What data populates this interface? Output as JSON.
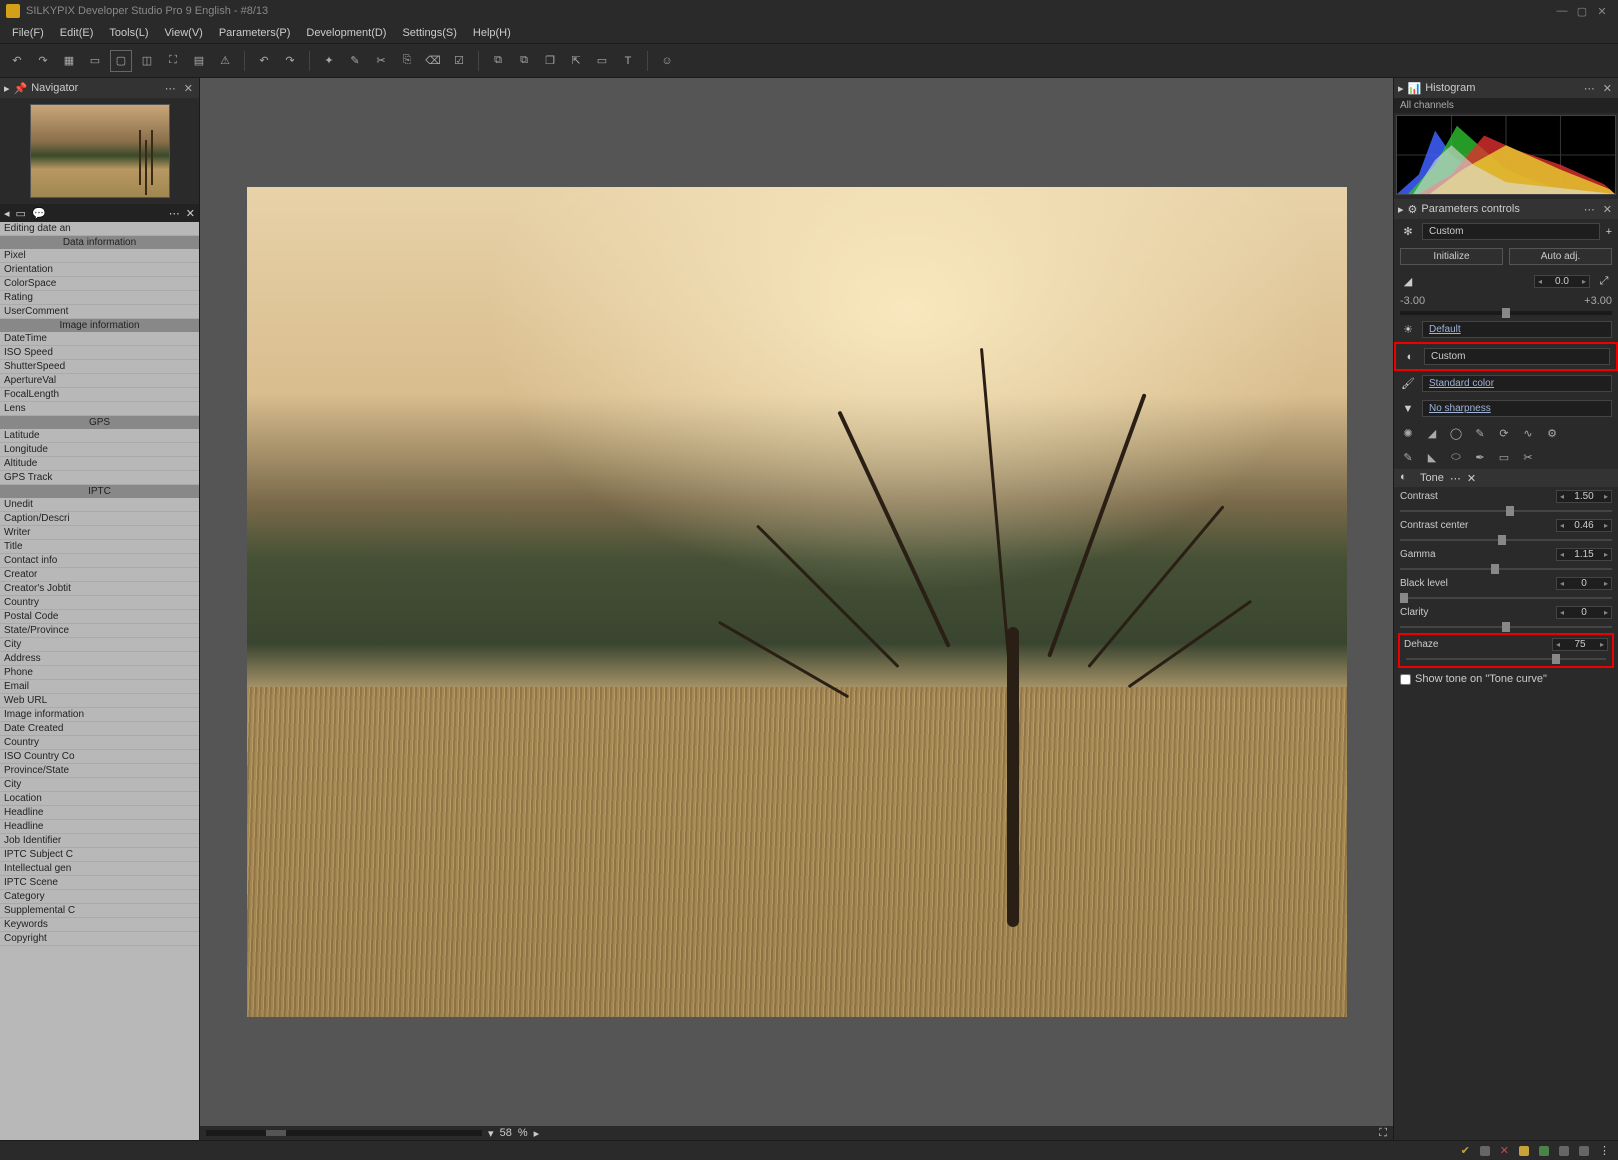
{
  "title": "SILKYPIX Developer Studio Pro 9 English - #8/13",
  "menu": [
    "File(F)",
    "Edit(E)",
    "Tools(L)",
    "View(V)",
    "Parameters(P)",
    "Development(D)",
    "Settings(S)",
    "Help(H)"
  ],
  "navigator": {
    "title": "Navigator"
  },
  "info_sections": {
    "editing": "Editing date an",
    "data": {
      "header": "Data information",
      "rows": [
        "Pixel",
        "Orientation",
        "ColorSpace",
        "Rating",
        "UserComment"
      ]
    },
    "image": {
      "header": "Image information",
      "rows": [
        "DateTime",
        "ISO Speed",
        "ShutterSpeed",
        "ApertureVal",
        "FocalLength",
        "Lens"
      ]
    },
    "gps": {
      "header": "GPS",
      "rows": [
        "Latitude",
        "Longitude",
        "Altitude",
        "GPS Track"
      ]
    },
    "iptc": {
      "header": "IPTC",
      "rows": [
        "Unedit",
        "Caption/Descri",
        "Writer",
        "Title",
        "Contact info",
        "Creator",
        "Creator's Jobtit",
        "Country",
        "Postal Code",
        "State/Province",
        "City",
        "Address",
        "Phone",
        "Email",
        "Web URL",
        "Image information",
        "Date Created",
        "Country",
        "ISO Country Co",
        "Province/State",
        "City",
        "Location",
        "Headline",
        "Headline",
        "Job Identifier",
        "IPTC Subject C",
        "Intellectual gen",
        "IPTC Scene",
        "Category",
        "Supplemental C",
        "Keywords",
        "Copyright"
      ]
    }
  },
  "zoom": {
    "value": "58",
    "unit": "%"
  },
  "histogram": {
    "title": "Histogram",
    "channels": "All channels"
  },
  "params_controls": {
    "title": "Parameters controls",
    "preset": "Custom",
    "init": "Initialize",
    "auto": "Auto adj.",
    "exp_value": "0.0",
    "exp_min": "-3.00",
    "exp_max": "+3.00"
  },
  "presets": {
    "wb": "Default",
    "tone": "Custom",
    "color": "Standard color",
    "sharp": "No sharpness"
  },
  "tone_panel": {
    "title": "Tone",
    "contrast": {
      "label": "Contrast",
      "value": "1.50",
      "pos": 52
    },
    "contrast_center": {
      "label": "Contrast center",
      "value": "0.46",
      "pos": 48
    },
    "gamma": {
      "label": "Gamma",
      "value": "1.15",
      "pos": 45
    },
    "black": {
      "label": "Black level",
      "value": "0",
      "pos": 2
    },
    "clarity": {
      "label": "Clarity",
      "value": "0",
      "pos": 50
    },
    "dehaze": {
      "label": "Dehaze",
      "value": "75",
      "pos": 75
    },
    "show_tone": "Show tone on \"Tone curve\""
  }
}
